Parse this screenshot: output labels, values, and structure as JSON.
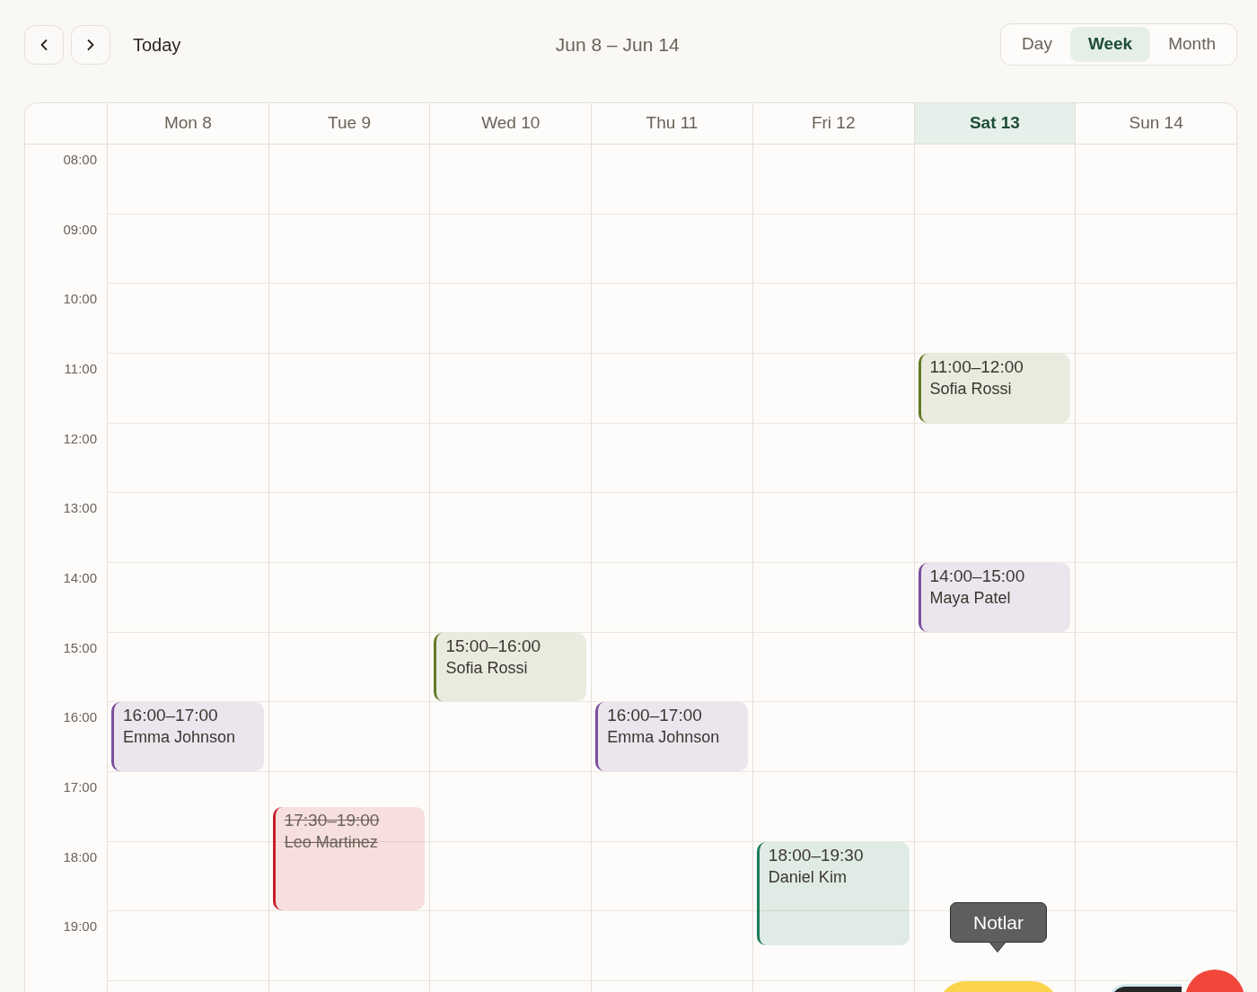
{
  "toolbar": {
    "today": "Today",
    "range": "Jun 8 – Jun 14",
    "views": [
      {
        "label": "Day",
        "selected": false
      },
      {
        "label": "Week",
        "selected": true
      },
      {
        "label": "Month",
        "selected": false
      }
    ]
  },
  "calendar": {
    "days": [
      {
        "label": "Mon 8",
        "selected": false,
        "events": [
          {
            "time": "16:00–17:00",
            "name": "Emma Johnson",
            "color": "#7b4f9d",
            "cancelled": false
          }
        ]
      },
      {
        "label": "Tue 9",
        "selected": false,
        "events": [
          {
            "time": "17:30–19:00",
            "name": "Leo Martinez",
            "color": "#c81e2a",
            "cancelled": true
          }
        ]
      },
      {
        "label": "Wed 10",
        "selected": false,
        "events": [
          {
            "time": "15:00–16:00",
            "name": "Sofia Rossi",
            "color": "#627a26",
            "cancelled": false
          }
        ]
      },
      {
        "label": "Thu 11",
        "selected": false,
        "events": [
          {
            "time": "16:00–17:00",
            "name": "Emma Johnson",
            "color": "#7b4f9d",
            "cancelled": false
          }
        ]
      },
      {
        "label": "Fri 12",
        "selected": false,
        "events": [
          {
            "time": "18:00–19:30",
            "name": "Daniel Kim",
            "color": "#1d7a5b",
            "cancelled": false
          }
        ]
      },
      {
        "label": "Sat 13",
        "selected": true,
        "events": [
          {
            "time": "11:00–12:00",
            "name": "Sofia Rossi",
            "color": "#627a26",
            "cancelled": false
          },
          {
            "time": "14:00–15:00",
            "name": "Maya Patel",
            "color": "#7b4f9d",
            "cancelled": false
          }
        ]
      },
      {
        "label": "Sun 14",
        "selected": false
      }
    ],
    "time_labels": [
      "08:00",
      "09:00",
      "10:00",
      "11:00",
      "12:00",
      "13:00",
      "14:00",
      "15:00",
      "16:00",
      "17:00",
      "18:00",
      "19:00"
    ]
  },
  "dock": {
    "tooltip": "Notlar"
  }
}
